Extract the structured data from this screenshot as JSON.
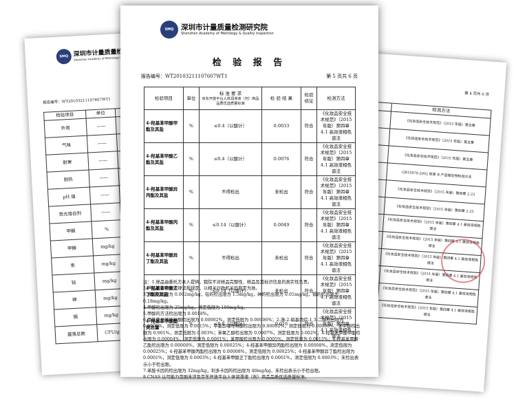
{
  "institute": {
    "cn": "深圳市计量质量检测研究院",
    "en": "Shenzhen Academy of Metrology & Quality Inspection",
    "seal": "SMQ"
  },
  "front": {
    "title": "检 验 报 告",
    "report_no": "报告编号：WT20103211107607WT1",
    "page": "第 5 页共 6 页",
    "headers": {
      "item": "检验项目",
      "unit": "单位",
      "std": "标 准 要 求",
      "std_sub": "京东开放平台人体润滑液（剂）商品品质优选质量标准",
      "result": "检 验 结 果",
      "judge": "检验结论",
      "method": "检测方法"
    },
    "rows": [
      {
        "item": "4-羟基苯甲酸甲酯及其盐",
        "unit": "%",
        "std": "≤0.4（以酸计）",
        "result": "0.0033",
        "judge": "符合",
        "method": "《化妆品安全技术规范》（2015 年版）第四章 4.1 高效液相色谱法"
      },
      {
        "item": "4-羟基苯甲酸乙酯及其盐",
        "unit": "%",
        "std": "≤0.4（以酸计）",
        "result": "0.0076",
        "judge": "符合",
        "method": "《化妆品安全技术规范》（2015 年版）第四章 4.1 高效液相色谱法"
      },
      {
        "item": "4-羟基苯甲酸异丙酯及其盐",
        "unit": "%",
        "std": "不得检出",
        "result": "未检出",
        "judge": "符合",
        "method": "《化妆品安全技术规范》（2015 年版）第四章 4.1 高效液相色谱法"
      },
      {
        "item": "4-羟基苯甲酸丙酯及其盐",
        "unit": "%",
        "std": "≤0.14（以酸计）",
        "result": "0.0049",
        "judge": "符合",
        "method": "《化妆品安全技术规范》（2015 年版）第四章 4.1 高效液相色谱法"
      },
      {
        "item": "4-羟基苯甲酸异丁酯及其盐",
        "unit": "%",
        "std": "不得检出",
        "result": "未检出",
        "judge": "符合",
        "method": "《化妆品安全技术规范》（2015 年版）第四章 4.1 高效液相色谱法"
      },
      {
        "item": "4-羟基苯甲酸正丁酯及其盐",
        "unit": "%",
        "std": "≤0.14（以酸计）",
        "result": "未检出",
        "judge": "符合",
        "method": "《化妆品安全技术规范》（2015 年版）第四章 4.1 高效液相色谱法"
      },
      {
        "item": "4-羟基苯甲酸酯类总量",
        "unit": "%",
        "std": "≤0.8（以酸计）",
        "result": "0.016",
        "judge": "符合",
        "method": "《化妆品安全技术规范》（2015 年版）第四章 4.1 高效液相色谱法"
      }
    ],
    "notes": [
      "注：1.样品由委托方本人提供，我院不对样品完整性、样品及其标识信息的真实性负责。",
      "2.产品是否符合法律法规规定，以相关行政机关的判定为准。",
      "3.汞的检出限为 0.002mg/kg，铅的检出限为 1.5mg/kg，砷的检出限为 0.01mg/kg，镉的检出限为 0.18mg/kg。",
      "4.甲醛检出限为 25mg/kg，测定低限为 100mg/kg。",
      "5.甲醇的方法检出限为 0.0018%。",
      "6.甲基氯异噻唑啉酮检出限为 0.00002%，测定低限为 0.00006%；2-溴-2-硝基丙烷-1,3-二醇检出限为 0.0005%，测定低限为 0.0015%；甲基异噻唑啉酮检出限为 0.00002%，测定低限为 0.00006%；苯甲醇检出限为 0.001%，测定低限为 0.003%；苯氧乙醇检出限为 0.0007%，测定低限为 0.002%；4-羟基苯甲酸甲酯检出限为 0.00004%，测定低限为 0.0001%；苯甲酸检出限为 0.0005%，测定低限为 0.0015%；4-羟基苯甲酸乙酯检出限为 0.00008%，测定低限为 0.00025%；4-羟基苯甲酸异丙酯检出限为 0.00008%，测定低限为 0.00025%；4-羟基苯甲酸丙酯检出限为 0.00008%，测定低限为 0.00025%；4-羟基苯甲酸异丁酯检出限为 0.0001%，测定低限为 0.0003%；4-羟基苯甲酸正丁酯检出限为 0.0001%，测定低限为 0.0003%；未检出表示小于检出限。",
      "7.苯胺卡因的检出限为 32mg/kg，利多卡因的检出限为 40mg/kg，未检出表示小于检出限。",
      "8.CNAS 认可能力范围未涉及京东开放平台人体润滑液（剂）商品品质优选质量标准。"
    ]
  },
  "left": {
    "report_no": "报告编号：WT20103211107607WT1",
    "headers": {
      "item": "检验项目",
      "unit": "单位",
      "std": "标 准"
    },
    "rows": [
      {
        "item": "外观",
        "unit": "——"
      },
      {
        "item": "气味",
        "unit": "——"
      },
      {
        "item": "耐寒",
        "unit": "——"
      },
      {
        "item": "耐热",
        "unit": "——"
      },
      {
        "item": "pH 值",
        "unit": "——"
      },
      {
        "item": "荧光增白剂",
        "unit": "——"
      },
      {
        "item": "甲醛",
        "unit": "%"
      },
      {
        "item": "甲醇",
        "unit": "mg/kg"
      },
      {
        "item": "汞",
        "unit": "mg/kg"
      },
      {
        "item": "铅",
        "unit": "mg/kg"
      },
      {
        "item": "砷",
        "unit": "mg/kg"
      },
      {
        "item": "镉",
        "unit": "mg/kg"
      },
      {
        "item": "菌落总数",
        "unit": "CFU/g"
      }
    ]
  },
  "right": {
    "page": "第 4 页共 6 页",
    "headers": {
      "judge": "检验结论",
      "method": "检测方法"
    },
    "rows": [
      {
        "result": "<10",
        "judge": "符合",
        "method": "《化妆品安全技术规范》（2015 年版）第五章"
      },
      {
        "result": "未检出",
        "judge": "符合",
        "method": "《化妆品安全技术规范》（2015 年版）第五章"
      },
      {
        "result": "未检出",
        "judge": "符合",
        "method": "《化妆品安全技术规范》（2015 年版）第五章"
      },
      {
        "result": "未检出",
        "judge": "符合",
        "method": "GB15979-2002 附录 B 产品微生物检测方法"
      },
      {
        "result": "未检出",
        "judge": "符合",
        "method": "《化妆品安全技术规范》（2015 年版）第四章 2.23"
      },
      {
        "result": "未检出",
        "judge": "符合",
        "method": "《化妆品安全技术规范》（2015 年版）第四章 2.23"
      },
      {
        "result": "未检出",
        "judge": "符合",
        "method": "《化妆品安全技术规范》（2015 年版）第四章 4.1 高效液相色谱法"
      },
      {
        "result": "未检出",
        "judge": "符合",
        "method": "《化妆品安全技术规范》（2015 年版）第四章 4.1 高效液相色谱法"
      },
      {
        "result": "未检出",
        "judge": "符合",
        "method": "《化妆品安全技术规范》（2015 年版）第四章 4.1 高效液相色谱法"
      },
      {
        "result": "0.018",
        "judge": "符合",
        "method": "《化妆品安全技术规范》（2015 年版）第四章 4.1 高效液相色谱法"
      },
      {
        "result": "未检出",
        "judge": "符合",
        "method": "《化妆品安全技术规范》（2015 年版）第四章 4.1 高效液相色谱法"
      },
      {
        "result": "未检出",
        "judge": "符合",
        "method": "《化妆品安全技术规范》（2015 年版）第四章 4.1 高效液相色谱法"
      }
    ]
  }
}
